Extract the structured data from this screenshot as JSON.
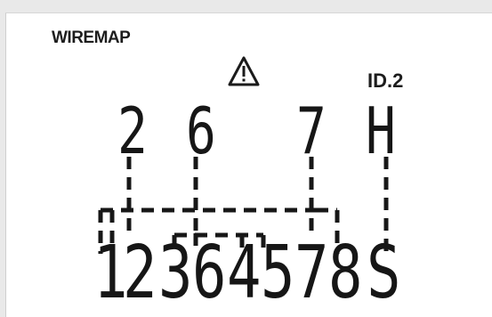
{
  "display": {
    "mode_label": "WIREMAP",
    "id_label": "ID.",
    "id_value": "2",
    "warning_icon": "warning-triangle-icon",
    "top_row": [
      "2",
      "6",
      "7",
      "H"
    ],
    "bottom_row": [
      "1",
      "2",
      "3",
      "6",
      "4",
      "5",
      "7",
      "8",
      "S"
    ]
  }
}
